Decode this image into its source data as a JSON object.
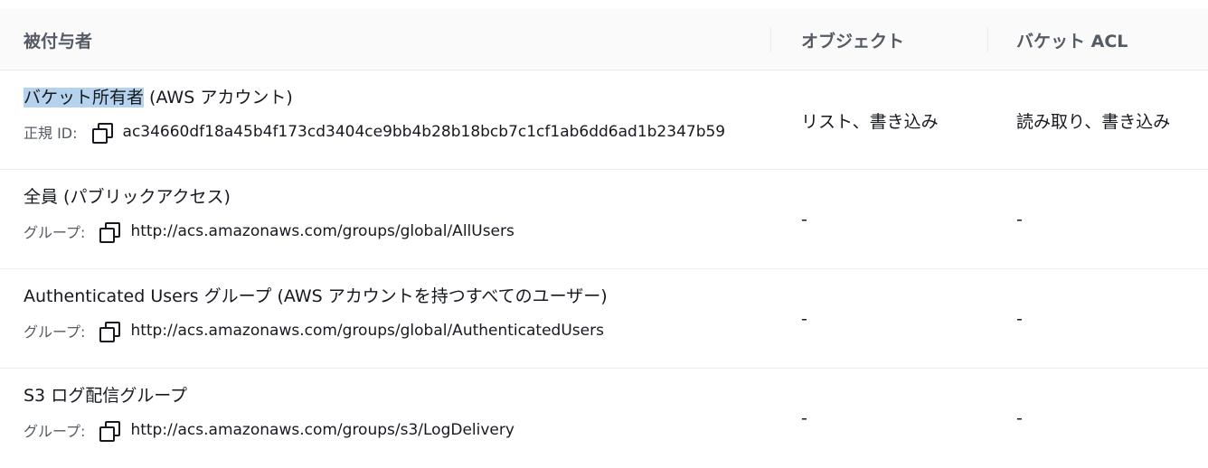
{
  "header": {
    "grantee": "被付与者",
    "objects": "オブジェクト",
    "bucket_acl": "バケット ACL"
  },
  "rows": [
    {
      "title_highlight": "バケット所有者",
      "title_rest": " (AWS アカウント)",
      "sub_label": "正規 ID:",
      "sub_value": "ac34660df18a45b4f173cd3404ce9bb4b28b18bcb7c1cf1ab6dd6ad1b2347b59",
      "objects": "リスト、書き込み",
      "bucket_acl": "読み取り、書き込み"
    },
    {
      "title": "全員 (パブリックアクセス)",
      "sub_label": "グループ:",
      "sub_value": "http://acs.amazonaws.com/groups/global/AllUsers",
      "objects": "-",
      "bucket_acl": "-"
    },
    {
      "title": "Authenticated Users グループ (AWS アカウントを持つすべてのユーザー)",
      "sub_label": "グループ:",
      "sub_value": "http://acs.amazonaws.com/groups/global/AuthenticatedUsers",
      "objects": "-",
      "bucket_acl": "-"
    },
    {
      "title": "S3 ログ配信グループ",
      "sub_label": "グループ:",
      "sub_value": "http://acs.amazonaws.com/groups/s3/LogDelivery",
      "objects": "-",
      "bucket_acl": "-"
    }
  ],
  "icons": {
    "copy": "copy-icon"
  }
}
